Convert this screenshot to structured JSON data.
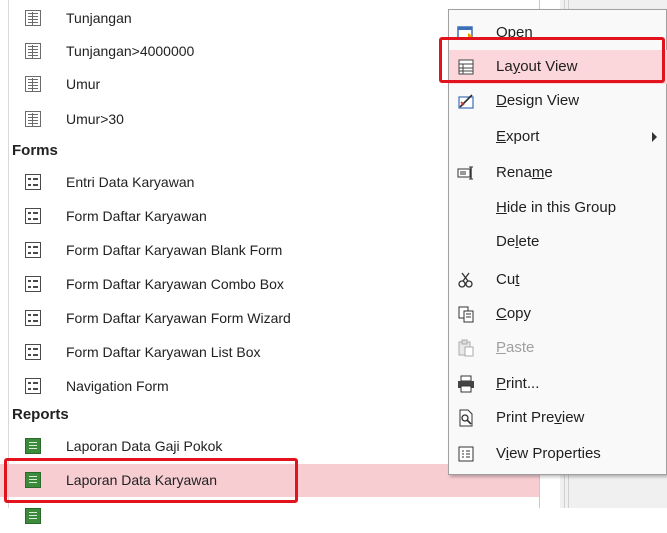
{
  "nav_pane": {
    "queries": [
      {
        "label": "Tunjangan"
      },
      {
        "label": "Tunjangan>4000000"
      },
      {
        "label": "Umur"
      },
      {
        "label": "Umur>30"
      }
    ],
    "forms_header": "Forms",
    "forms": [
      {
        "label": "Entri Data Karyawan"
      },
      {
        "label": "Form Daftar Karyawan"
      },
      {
        "label": "Form Daftar Karyawan Blank Form"
      },
      {
        "label": "Form Daftar Karyawan Combo Box"
      },
      {
        "label": "Form Daftar Karyawan Form Wizard"
      },
      {
        "label": "Form Daftar Karyawan List Box"
      },
      {
        "label": "Navigation Form"
      }
    ],
    "reports_header": "Reports",
    "reports": [
      {
        "label": "Laporan Data Gaji Pokok"
      },
      {
        "label": "Laporan Data Karyawan",
        "selected": true
      }
    ]
  },
  "context_menu": {
    "items": [
      {
        "pre": "",
        "u": "O",
        "post": "pen",
        "icon": "open-icon"
      },
      {
        "pre": "La",
        "u": "y",
        "post": "out View",
        "icon": "layout-view-icon",
        "hover": true
      },
      {
        "pre": "",
        "u": "D",
        "post": "esign View",
        "icon": "design-view-icon"
      },
      {
        "pre": "",
        "u": "E",
        "post": "xport",
        "icon": "",
        "submenu": true
      },
      {
        "pre": "Rena",
        "u": "m",
        "post": "e",
        "icon": "rename-icon"
      },
      {
        "pre": "",
        "u": "H",
        "post": "ide in this Group",
        "icon": ""
      },
      {
        "pre": "De",
        "u": "l",
        "post": "ete",
        "icon": ""
      },
      {
        "pre": "Cu",
        "u": "t",
        "post": "",
        "icon": "scissors-icon"
      },
      {
        "pre": "",
        "u": "C",
        "post": "opy",
        "icon": "copy-icon"
      },
      {
        "pre": "",
        "u": "P",
        "post": "aste",
        "icon": "paste-icon",
        "disabled": true
      },
      {
        "pre": "",
        "u": "P",
        "post": "rint...",
        "icon": "printer-icon"
      },
      {
        "pre": "Print Pre",
        "u": "v",
        "post": "iew",
        "icon": "print-preview-icon"
      },
      {
        "pre": "V",
        "u": "i",
        "post": "ew Properties",
        "icon": "properties-icon"
      }
    ]
  },
  "colors": {
    "highlight_red": "#e2131d",
    "selected_bg": "#f7cdd2",
    "report_icon_green": "#3c8a3c"
  }
}
